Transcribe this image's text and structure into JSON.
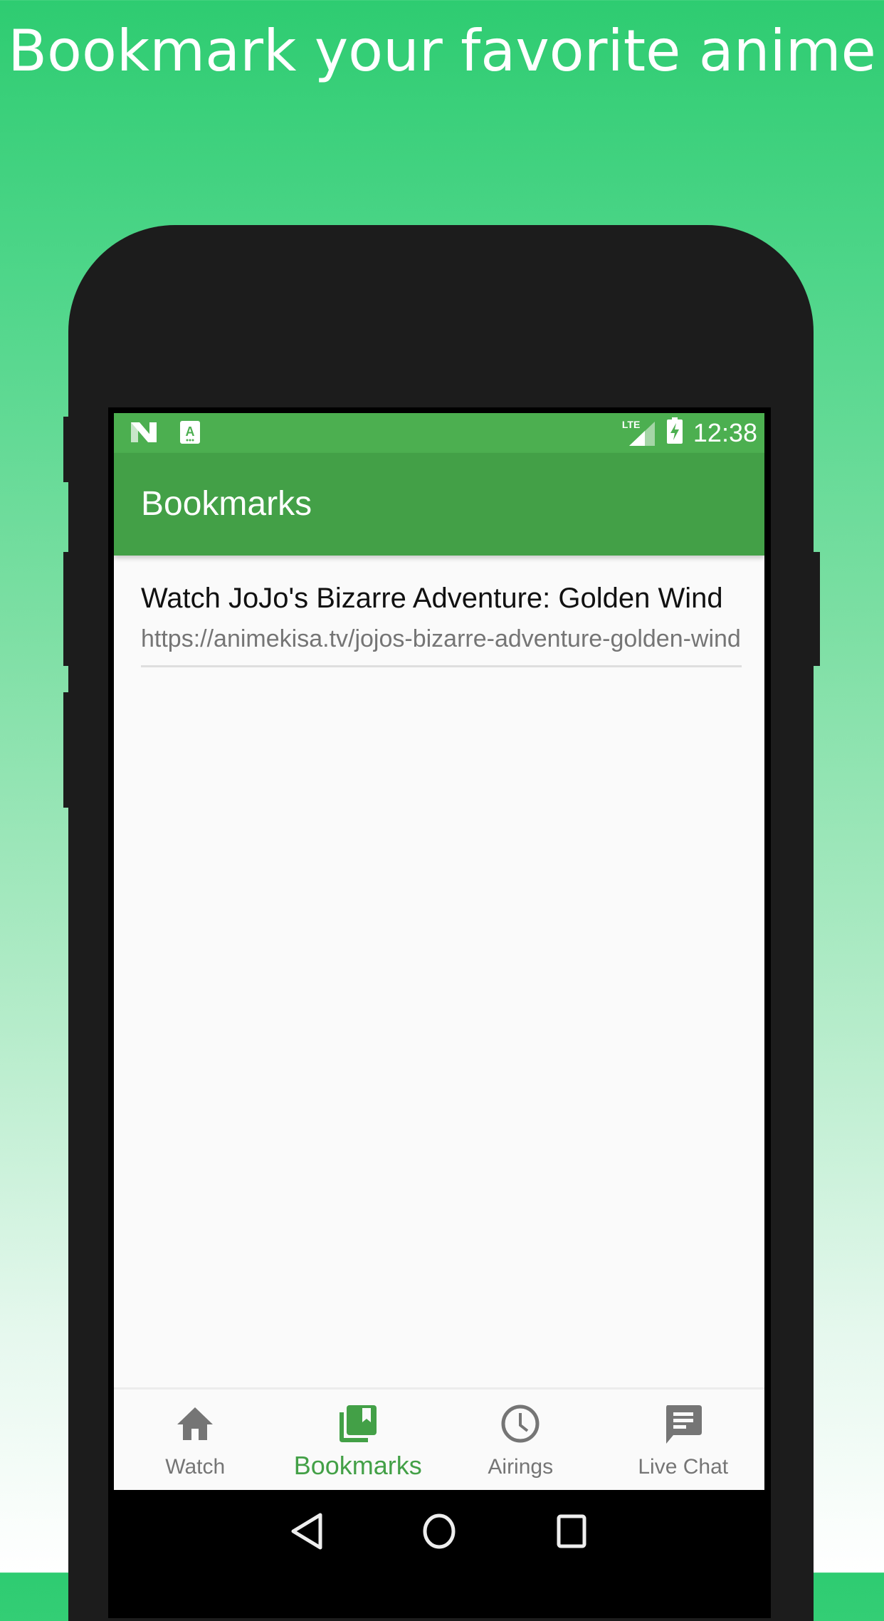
{
  "promo": {
    "headline": "Bookmark your favorite anime"
  },
  "status_bar": {
    "left_icons": [
      "n-logo-icon",
      "a-notification-icon"
    ],
    "network_label": "LTE",
    "time": "12:38"
  },
  "app_bar": {
    "title": "Bookmarks"
  },
  "bookmarks": [
    {
      "title": "Watch JoJo's Bizarre Adventure: Golden Wind",
      "url": "https://animekisa.tv/jojos-bizarre-adventure-golden-wind"
    }
  ],
  "bottom_nav": {
    "tabs": [
      {
        "label": "Watch",
        "icon": "home-icon",
        "active": false
      },
      {
        "label": "Bookmarks",
        "icon": "bookmarks-icon",
        "active": true
      },
      {
        "label": "Airings",
        "icon": "clock-icon",
        "active": false
      },
      {
        "label": "Live Chat",
        "icon": "chat-icon",
        "active": false
      }
    ]
  },
  "colors": {
    "primary": "#43a047",
    "status_bar": "#4caf50",
    "inactive": "#757575"
  }
}
